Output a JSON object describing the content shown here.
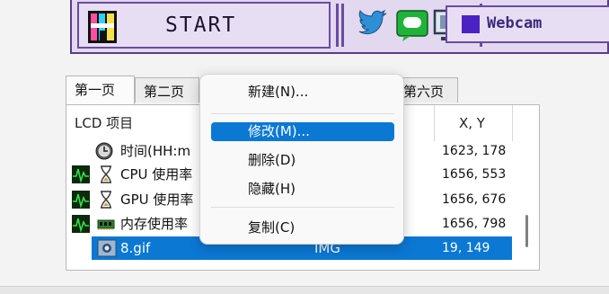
{
  "toolbar": {
    "start_label": "START",
    "icons": [
      "twitter-bird-icon",
      "chat-bubble-icon",
      "monitor-icon"
    ],
    "webcam_label": "Webcam",
    "colors": {
      "bg": "#e2d8ef",
      "border": "#5a3c86",
      "twitter": "#2d8fd6",
      "chat": "#20b33a",
      "webcam_swatch": "#4b22c2"
    }
  },
  "tabs": [
    "第一页",
    "第二页",
    "第六页"
  ],
  "list": {
    "columns": [
      "LCD 项目",
      "X, Y"
    ],
    "rows": [
      {
        "name": "时间(HH:m",
        "type": "",
        "xy": "1623, 178",
        "icons": [
          "clock-icon"
        ]
      },
      {
        "name": "CPU 使用率",
        "type": "",
        "xy": "1656, 553",
        "icons": [
          "activity-graph-icon",
          "hourglass-icon"
        ]
      },
      {
        "name": "GPU 使用率",
        "type": "",
        "xy": "1656, 676",
        "icons": [
          "activity-graph-icon",
          "hourglass-icon"
        ]
      },
      {
        "name": "内存使用率",
        "type": "",
        "xy": "1656, 798",
        "icons": [
          "activity-graph-icon",
          "memory-chip-icon"
        ]
      },
      {
        "name": "8.gif",
        "type": "IMG",
        "xy": "19, 149",
        "icons": [
          "image-file-icon"
        ],
        "selected": true
      }
    ]
  },
  "context_menu": {
    "items": [
      {
        "label": "新建(N)..."
      },
      {
        "label": "修改(M)...",
        "highlighted": true
      },
      {
        "label": "删除(D)"
      },
      {
        "label": "隐藏(H)"
      },
      {
        "label": "复制(C)"
      }
    ]
  },
  "colors": {
    "selection": "#0b78d4",
    "menu_bg": "#f9f9f9"
  }
}
